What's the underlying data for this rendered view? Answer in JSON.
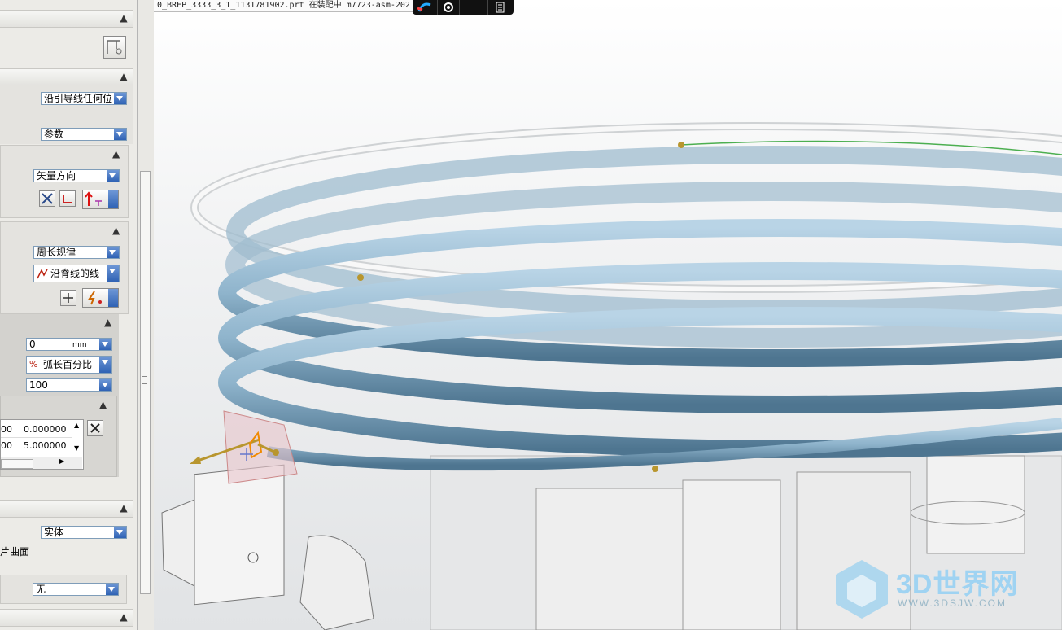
{
  "window": {
    "title": "0_BREP_3333_3_1_1131781902.prt  在装配中  m7723-asm-202"
  },
  "panel": {
    "orient_method": "沿引导线任何位",
    "orient_sub": "参数",
    "direction_method": "矢量方向",
    "scaling_method": "周长规律",
    "scaling_option": "沿脊线的线",
    "value_input": "0",
    "value_unit": "mm",
    "mode_dropdown": "弧长百分比",
    "percent_input": "100",
    "table": {
      "rows": [
        {
          "left": "00",
          "right": "0.000000"
        },
        {
          "left": "00",
          "right": "5.000000"
        }
      ]
    },
    "body_type": "实体",
    "sheet_label": "片曲面",
    "none_dropdown": "无"
  },
  "watermark": {
    "brand": "3D世界网",
    "url": "WWW.3DSJW.COM"
  },
  "colors": {
    "tube": "#8fb4cc",
    "tube_dark": "#4e7590",
    "accent": "#2f62b4"
  }
}
